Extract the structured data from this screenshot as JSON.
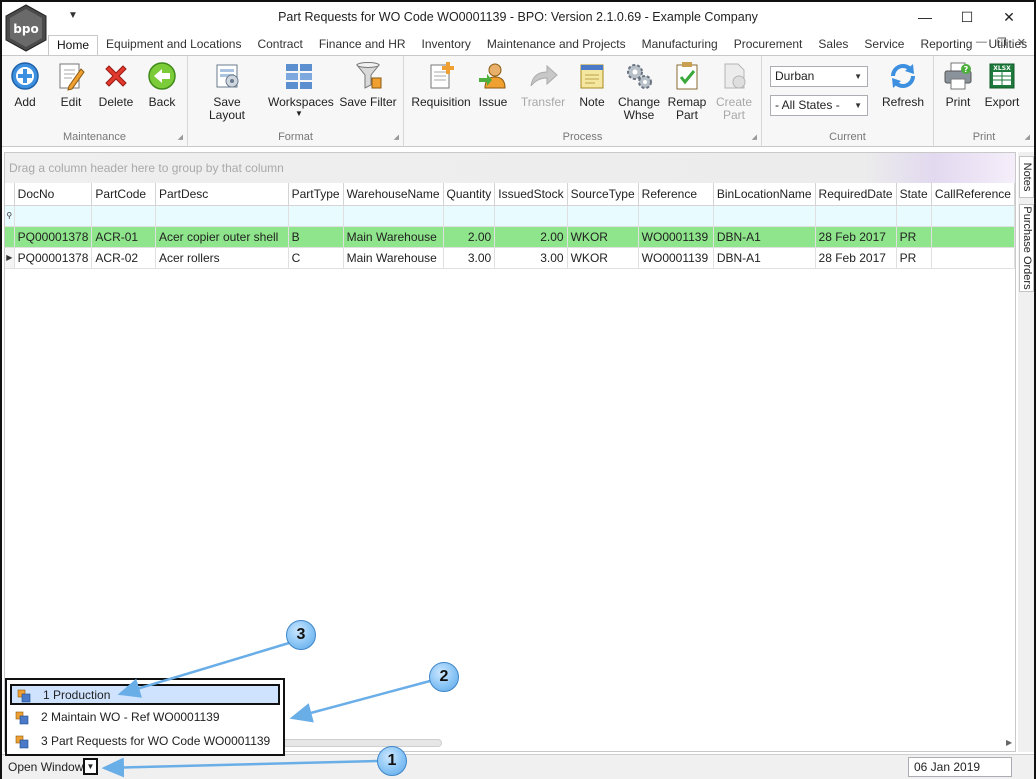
{
  "window": {
    "title": "Part Requests for WO Code WO0001139 - BPO: Version 2.1.0.69 - Example Company",
    "logo_text": "bpo"
  },
  "tabs": [
    "Home",
    "Equipment and Locations",
    "Contract",
    "Finance and HR",
    "Inventory",
    "Maintenance and Projects",
    "Manufacturing",
    "Procurement",
    "Sales",
    "Service",
    "Reporting",
    "Utilities"
  ],
  "ribbon": {
    "maintenance": {
      "label": "Maintenance",
      "add": "Add",
      "edit": "Edit",
      "delete": "Delete",
      "back": "Back"
    },
    "format": {
      "label": "Format",
      "save_layout": "Save Layout",
      "workspaces": "Workspaces",
      "save_filter": "Save Filter"
    },
    "process": {
      "label": "Process",
      "requisition": "Requisition",
      "issue": "Issue",
      "transfer": "Transfer",
      "note": "Note",
      "change_whse_1": "Change",
      "change_whse_2": "Whse",
      "remap_part_1": "Remap",
      "remap_part_2": "Part",
      "create_part_1": "Create",
      "create_part_2": "Part"
    },
    "current": {
      "label": "Current",
      "site": "Durban",
      "states": "- All States -",
      "refresh": "Refresh"
    },
    "print": {
      "label": "Print",
      "print": "Print",
      "export": "Export"
    }
  },
  "grid": {
    "group_hint": "Drag a column header here to group by that column",
    "columns": [
      "DocNo",
      "PartCode",
      "PartDesc",
      "PartType",
      "WarehouseName",
      "Quantity",
      "IssuedStock",
      "SourceType",
      "Reference",
      "BinLocationName",
      "RequiredDate",
      "State",
      "CallReference"
    ],
    "rows": [
      [
        "PQ00001378",
        "ACR-01",
        "Acer copier outer shell",
        "B",
        "Main Warehouse",
        "2.00",
        "2.00",
        "WKOR",
        "WO0001139",
        "DBN-A1",
        "28 Feb 2017",
        "PR",
        ""
      ],
      [
        "PQ00001378",
        "ACR-02",
        "Acer rollers",
        "C",
        "Main Warehouse",
        "3.00",
        "3.00",
        "WKOR",
        "WO0001139",
        "DBN-A1",
        "28 Feb 2017",
        "PR",
        ""
      ]
    ]
  },
  "side_tabs": {
    "notes": "Notes",
    "purchase_orders": "Purchase Orders"
  },
  "open_windows": {
    "label": "Open Windows",
    "items": [
      "1 Production",
      "2 Maintain WO - Ref WO0001139",
      "3 Part Requests for WO Code WO0001139"
    ]
  },
  "status": {
    "date": "06 Jan 2019"
  },
  "callouts": [
    "1",
    "2",
    "3"
  ],
  "colors": {
    "selected_row": "#8ee58b",
    "filter_row": "#e8fbff",
    "callout": "#88c4f5",
    "arrow": "#6aaee8"
  }
}
